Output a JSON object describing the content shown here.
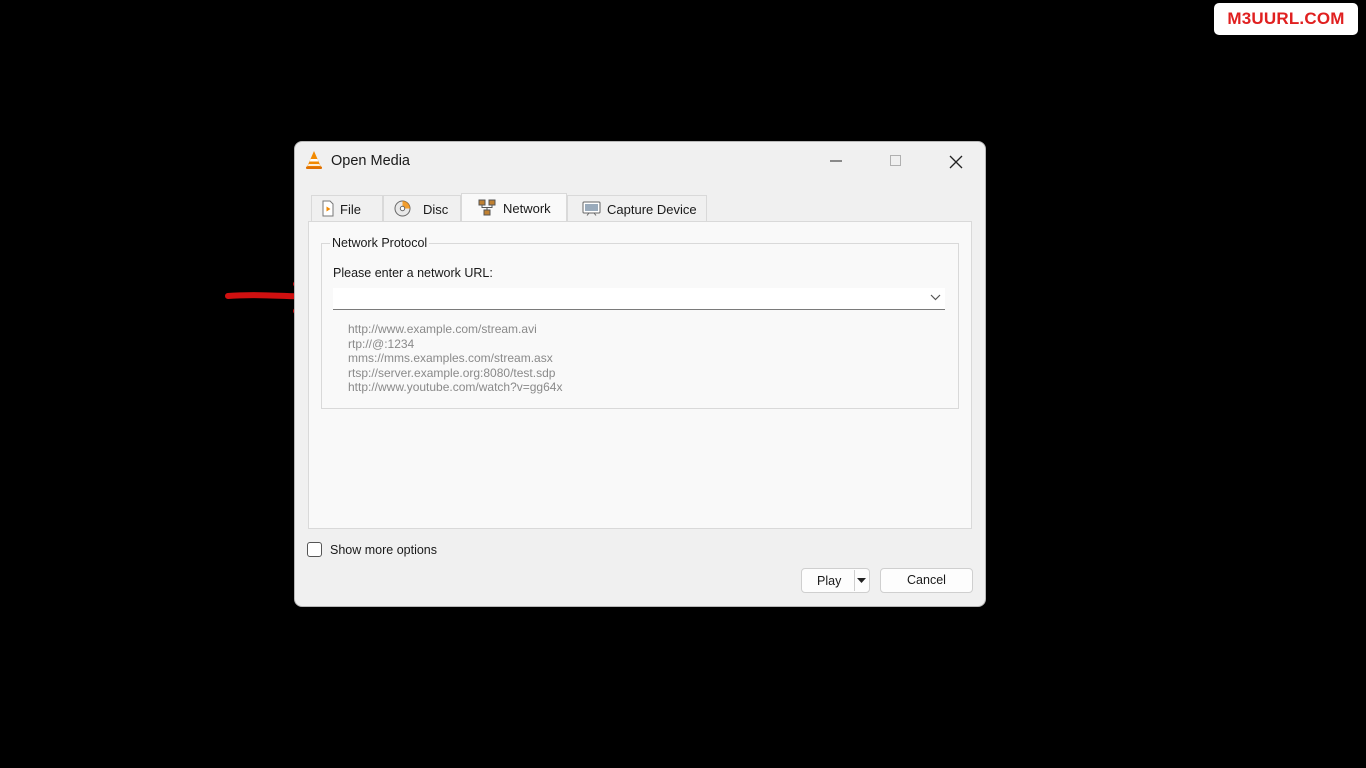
{
  "watermark": "M3UURL.COM",
  "window": {
    "title": "Open Media",
    "icon": "vlc-cone-icon",
    "controls": [
      "minimize-icon",
      "maximize-icon",
      "close-icon"
    ]
  },
  "tabs": [
    {
      "label": "File",
      "icon": "file-icon",
      "active": false
    },
    {
      "label": "Disc",
      "icon": "disc-icon",
      "active": false
    },
    {
      "label": "Network",
      "icon": "network-icon",
      "active": true
    },
    {
      "label": "Capture Device",
      "icon": "capture-device-icon",
      "active": false
    }
  ],
  "network": {
    "group_title": "Network Protocol",
    "url_label": "Please enter a network URL:",
    "url_value": "",
    "examples": [
      "http://www.example.com/stream.avi",
      "rtp://@:1234",
      "mms://mms.examples.com/stream.asx",
      "rtsp://server.example.org:8080/test.sdp",
      "http://www.youtube.com/watch?v=gg64x"
    ]
  },
  "options": {
    "show_more_label": "Show more options",
    "show_more_checked": false
  },
  "buttons": {
    "play": "Play",
    "cancel": "Cancel"
  },
  "colors": {
    "annotation_arrow": "#d01010",
    "watermark_text": "#e02020",
    "vlc_orange": "#f28a00"
  }
}
